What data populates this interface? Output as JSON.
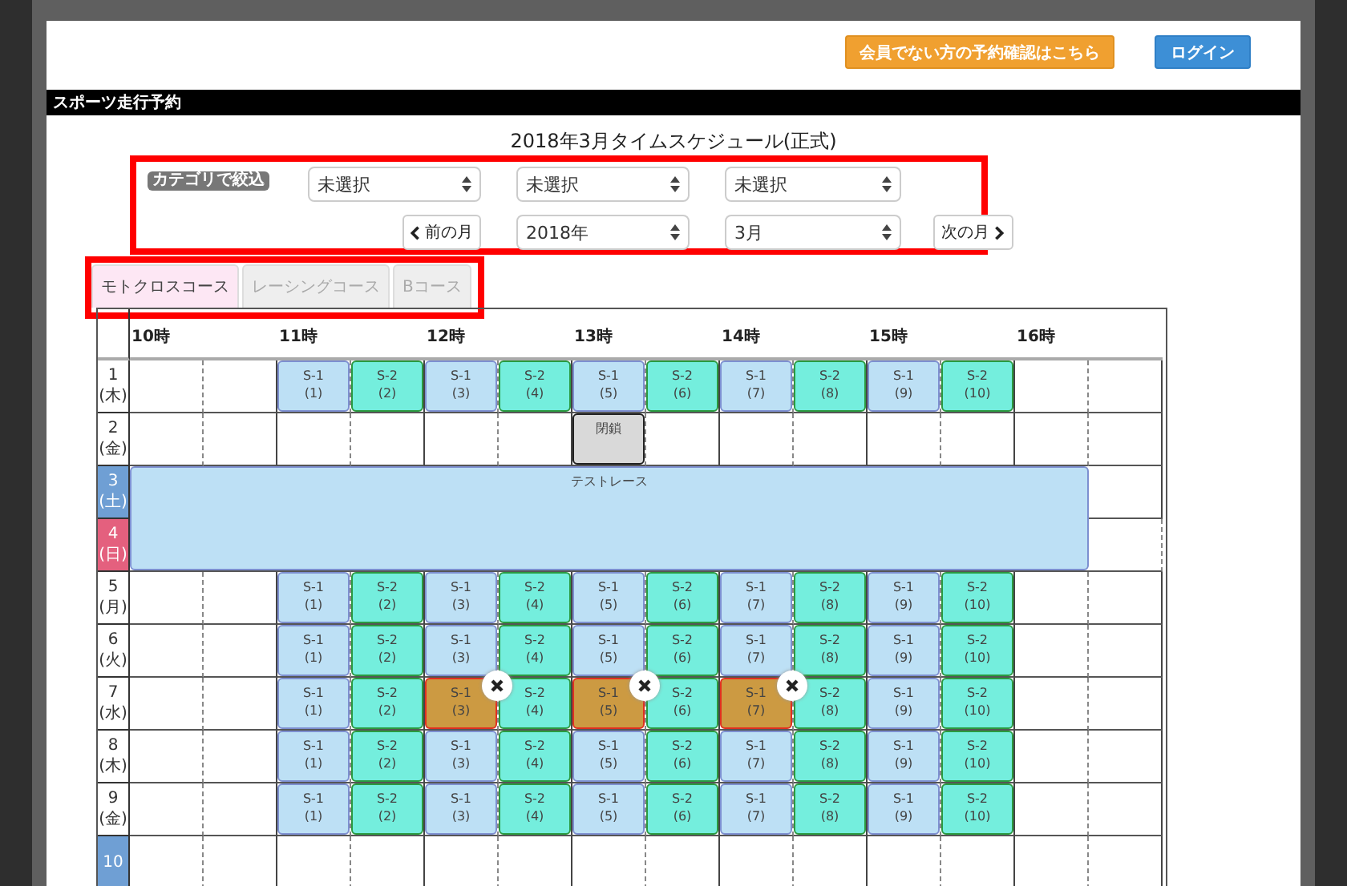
{
  "header": {
    "buttons": [
      {
        "label": "会員でない方の予約確認はこちら",
        "kind": "warning"
      },
      {
        "label": "ログイン",
        "kind": "primary"
      }
    ]
  },
  "section_title": "スポーツ走行予約",
  "page_title": "2018年3月タイムスケジュール(正式)",
  "filter": {
    "badge": "カテゴリで絞込",
    "categories": [
      "未選択",
      "未選択",
      "未選択"
    ],
    "prev_button": "前の月",
    "year": "2018年",
    "month": "3月",
    "next_button": "次の月"
  },
  "tabs": [
    {
      "label": "モトクロスコース",
      "selected": true
    },
    {
      "label": "レーシングコース",
      "selected": false
    },
    {
      "label": "Bコース",
      "selected": false
    }
  ],
  "schedule": {
    "hours": [
      "10時",
      "11時",
      "12時",
      "13時",
      "14時",
      "15時",
      "16時"
    ],
    "rows": [
      {
        "day": "1",
        "weekday": "(木)",
        "kind": "weekday",
        "cells": [
          {
            "kind": "empty"
          },
          {
            "kind": "empty"
          },
          {
            "kind": "s1",
            "label": "S-1",
            "number": "(1)",
            "booked": false
          },
          {
            "kind": "s2",
            "label": "S-2",
            "number": "(2)",
            "booked": false
          },
          {
            "kind": "s1",
            "label": "S-1",
            "number": "(3)",
            "booked": false
          },
          {
            "kind": "s2",
            "label": "S-2",
            "number": "(4)",
            "booked": false
          },
          {
            "kind": "s1",
            "label": "S-1",
            "number": "(5)",
            "booked": false
          },
          {
            "kind": "s2",
            "label": "S-2",
            "number": "(6)",
            "booked": false
          },
          {
            "kind": "s1",
            "label": "S-1",
            "number": "(7)",
            "booked": false
          },
          {
            "kind": "s2",
            "label": "S-2",
            "number": "(8)",
            "booked": false
          },
          {
            "kind": "s1",
            "label": "S-1",
            "number": "(9)",
            "booked": false
          },
          {
            "kind": "s2",
            "label": "S-2",
            "number": "(10)",
            "booked": false
          },
          {
            "kind": "empty"
          },
          {
            "kind": "empty"
          }
        ]
      },
      {
        "day": "2",
        "weekday": "(金)",
        "kind": "weekday",
        "cells": [
          {
            "kind": "empty"
          },
          {
            "kind": "empty"
          },
          {
            "kind": "empty"
          },
          {
            "kind": "empty"
          },
          {
            "kind": "empty"
          },
          {
            "kind": "empty"
          },
          {
            "kind": "closed",
            "label": "閉鎖"
          },
          {
            "kind": "empty"
          },
          {
            "kind": "empty"
          },
          {
            "kind": "empty"
          },
          {
            "kind": "empty"
          },
          {
            "kind": "empty"
          },
          {
            "kind": "empty"
          },
          {
            "kind": "empty"
          }
        ]
      },
      {
        "day": "3",
        "weekday": "(土)",
        "kind": "saturday",
        "cells": [
          {
            "kind": "event",
            "label": "テストレース"
          },
          {
            "kind": "empty"
          }
        ]
      },
      {
        "day": "4",
        "weekday": "(日)",
        "kind": "sunday",
        "cells": [
          {
            "kind": "empty"
          }
        ]
      },
      {
        "day": "5",
        "weekday": "(月)",
        "kind": "weekday",
        "cells": [
          {
            "kind": "empty"
          },
          {
            "kind": "empty"
          },
          {
            "kind": "s1",
            "label": "S-1",
            "number": "(1)",
            "booked": false
          },
          {
            "kind": "s2",
            "label": "S-2",
            "number": "(2)",
            "booked": false
          },
          {
            "kind": "s1",
            "label": "S-1",
            "number": "(3)",
            "booked": false
          },
          {
            "kind": "s2",
            "label": "S-2",
            "number": "(4)",
            "booked": false
          },
          {
            "kind": "s1",
            "label": "S-1",
            "number": "(5)",
            "booked": false
          },
          {
            "kind": "s2",
            "label": "S-2",
            "number": "(6)",
            "booked": false
          },
          {
            "kind": "s1",
            "label": "S-1",
            "number": "(7)",
            "booked": false
          },
          {
            "kind": "s2",
            "label": "S-2",
            "number": "(8)",
            "booked": false
          },
          {
            "kind": "s1",
            "label": "S-1",
            "number": "(9)",
            "booked": false
          },
          {
            "kind": "s2",
            "label": "S-2",
            "number": "(10)",
            "booked": false
          },
          {
            "kind": "empty"
          },
          {
            "kind": "empty"
          }
        ]
      },
      {
        "day": "6",
        "weekday": "(火)",
        "kind": "weekday",
        "cells": [
          {
            "kind": "empty"
          },
          {
            "kind": "empty"
          },
          {
            "kind": "s1",
            "label": "S-1",
            "number": "(1)",
            "booked": false
          },
          {
            "kind": "s2",
            "label": "S-2",
            "number": "(2)",
            "booked": false
          },
          {
            "kind": "s1",
            "label": "S-1",
            "number": "(3)",
            "booked": false
          },
          {
            "kind": "s2",
            "label": "S-2",
            "number": "(4)",
            "booked": false
          },
          {
            "kind": "s1",
            "label": "S-1",
            "number": "(5)",
            "booked": false
          },
          {
            "kind": "s2",
            "label": "S-2",
            "number": "(6)",
            "booked": false
          },
          {
            "kind": "s1",
            "label": "S-1",
            "number": "(7)",
            "booked": false
          },
          {
            "kind": "s2",
            "label": "S-2",
            "number": "(8)",
            "booked": false
          },
          {
            "kind": "s1",
            "label": "S-1",
            "number": "(9)",
            "booked": false
          },
          {
            "kind": "s2",
            "label": "S-2",
            "number": "(10)",
            "booked": false
          },
          {
            "kind": "empty"
          },
          {
            "kind": "empty"
          }
        ]
      },
      {
        "day": "7",
        "weekday": "(水)",
        "kind": "weekday",
        "cells": [
          {
            "kind": "empty"
          },
          {
            "kind": "empty"
          },
          {
            "kind": "s1",
            "label": "S-1",
            "number": "(1)",
            "booked": false
          },
          {
            "kind": "s2",
            "label": "S-2",
            "number": "(2)",
            "booked": false
          },
          {
            "kind": "s1",
            "label": "S-1",
            "number": "(3)",
            "booked": true
          },
          {
            "kind": "s2",
            "label": "S-2",
            "number": "(4)",
            "booked": false
          },
          {
            "kind": "s1",
            "label": "S-1",
            "number": "(5)",
            "booked": true
          },
          {
            "kind": "s2",
            "label": "S-2",
            "number": "(6)",
            "booked": false
          },
          {
            "kind": "s1",
            "label": "S-1",
            "number": "(7)",
            "booked": true
          },
          {
            "kind": "s2",
            "label": "S-2",
            "number": "(8)",
            "booked": false
          },
          {
            "kind": "s1",
            "label": "S-1",
            "number": "(9)",
            "booked": false
          },
          {
            "kind": "s2",
            "label": "S-2",
            "number": "(10)",
            "booked": false
          },
          {
            "kind": "empty"
          },
          {
            "kind": "empty"
          }
        ]
      },
      {
        "day": "8",
        "weekday": "(木)",
        "kind": "weekday",
        "cells": [
          {
            "kind": "empty"
          },
          {
            "kind": "empty"
          },
          {
            "kind": "s1",
            "label": "S-1",
            "number": "(1)",
            "booked": false
          },
          {
            "kind": "s2",
            "label": "S-2",
            "number": "(2)",
            "booked": false
          },
          {
            "kind": "s1",
            "label": "S-1",
            "number": "(3)",
            "booked": false
          },
          {
            "kind": "s2",
            "label": "S-2",
            "number": "(4)",
            "booked": false
          },
          {
            "kind": "s1",
            "label": "S-1",
            "number": "(5)",
            "booked": false
          },
          {
            "kind": "s2",
            "label": "S-2",
            "number": "(6)",
            "booked": false
          },
          {
            "kind": "s1",
            "label": "S-1",
            "number": "(7)",
            "booked": false
          },
          {
            "kind": "s2",
            "label": "S-2",
            "number": "(8)",
            "booked": false
          },
          {
            "kind": "s1",
            "label": "S-1",
            "number": "(9)",
            "booked": false
          },
          {
            "kind": "s2",
            "label": "S-2",
            "number": "(10)",
            "booked": false
          },
          {
            "kind": "empty"
          },
          {
            "kind": "empty"
          }
        ]
      },
      {
        "day": "9",
        "weekday": "(金)",
        "kind": "weekday",
        "cells": [
          {
            "kind": "empty"
          },
          {
            "kind": "empty"
          },
          {
            "kind": "s1",
            "label": "S-1",
            "number": "(1)",
            "booked": false
          },
          {
            "kind": "s2",
            "label": "S-2",
            "number": "(2)",
            "booked": false
          },
          {
            "kind": "s1",
            "label": "S-1",
            "number": "(3)",
            "booked": false
          },
          {
            "kind": "s2",
            "label": "S-2",
            "number": "(4)",
            "booked": false
          },
          {
            "kind": "s1",
            "label": "S-1",
            "number": "(5)",
            "booked": false
          },
          {
            "kind": "s2",
            "label": "S-2",
            "number": "(6)",
            "booked": false
          },
          {
            "kind": "s1",
            "label": "S-1",
            "number": "(7)",
            "booked": false
          },
          {
            "kind": "s2",
            "label": "S-2",
            "number": "(8)",
            "booked": false
          },
          {
            "kind": "s1",
            "label": "S-1",
            "number": "(9)",
            "booked": false
          },
          {
            "kind": "s2",
            "label": "S-2",
            "number": "(10)",
            "booked": false
          },
          {
            "kind": "empty"
          },
          {
            "kind": "empty"
          }
        ]
      },
      {
        "day": "10",
        "kind": "saturday",
        "cells": [
          {
            "kind": "empty"
          },
          {
            "kind": "empty"
          },
          {
            "kind": "empty"
          },
          {
            "kind": "empty"
          },
          {
            "kind": "empty"
          },
          {
            "kind": "empty"
          },
          {
            "kind": "empty"
          },
          {
            "kind": "empty"
          },
          {
            "kind": "empty"
          },
          {
            "kind": "empty"
          },
          {
            "kind": "empty"
          },
          {
            "kind": "empty"
          },
          {
            "kind": "empty"
          },
          {
            "kind": "empty"
          }
        ]
      }
    ]
  }
}
